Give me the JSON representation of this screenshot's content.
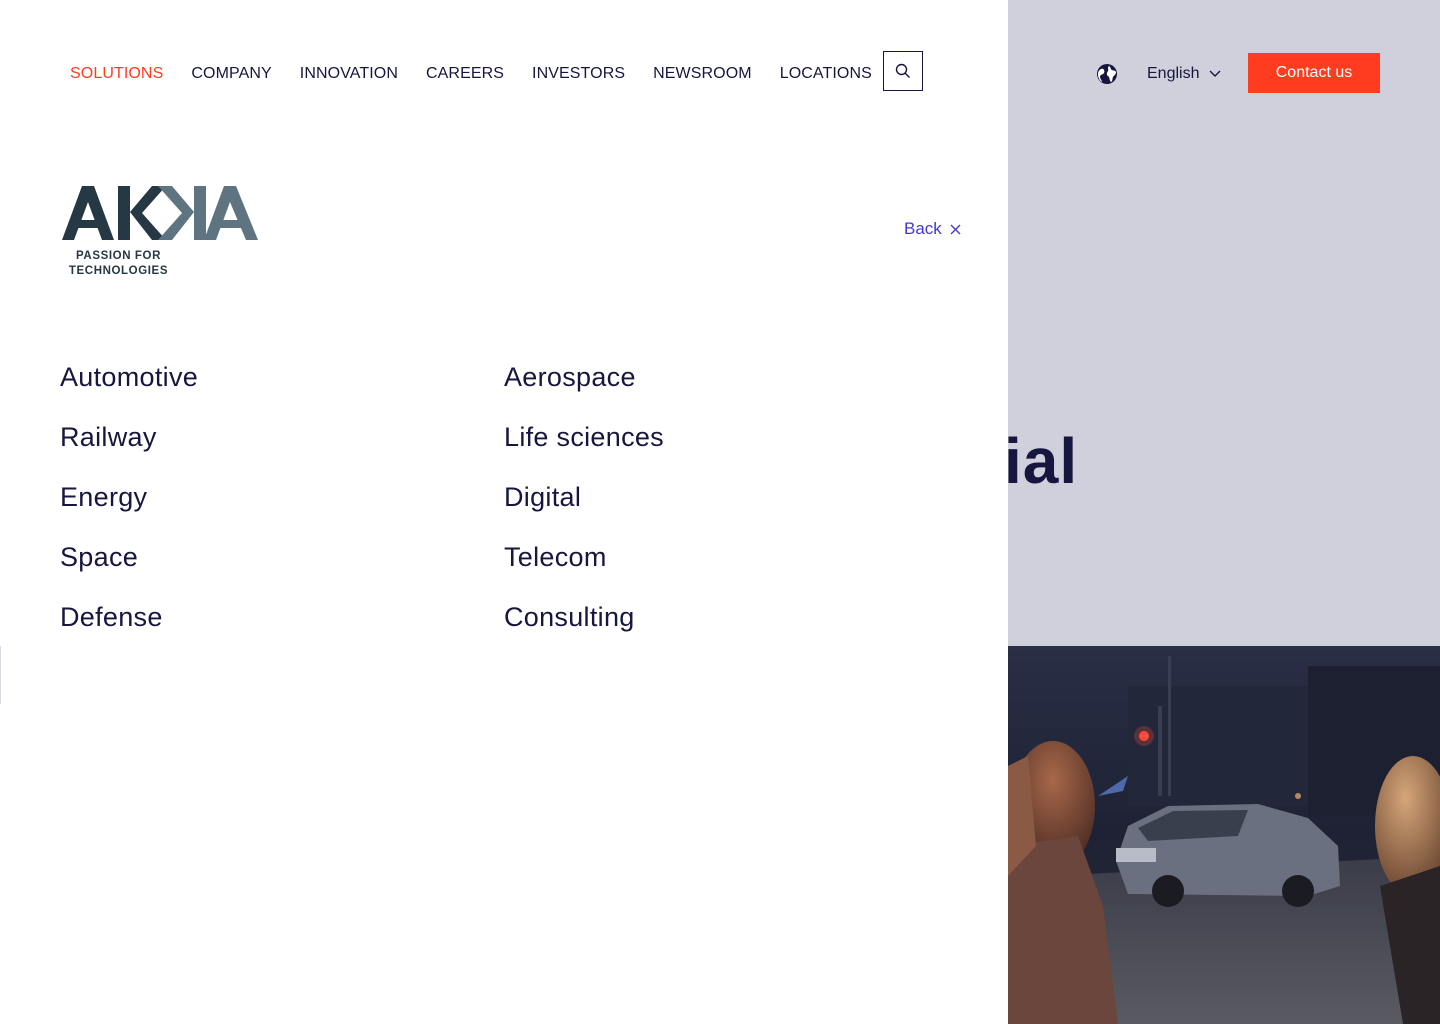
{
  "nav": {
    "items": [
      {
        "label": "SOLUTIONS",
        "active": true
      },
      {
        "label": "COMPANY",
        "active": false
      },
      {
        "label": "INNOVATION",
        "active": false
      },
      {
        "label": "CAREERS",
        "active": false
      },
      {
        "label": "INVESTORS",
        "active": false
      },
      {
        "label": "NEWSROOM",
        "active": false
      },
      {
        "label": "LOCATIONS",
        "active": false
      }
    ],
    "search_icon": "search-icon"
  },
  "header_right": {
    "globe_icon": "globe-icon",
    "language": "English",
    "contact_label": "Contact us"
  },
  "logo": {
    "wordmark": "AKKA",
    "tagline_line1": "PASSION FOR",
    "tagline_line2": "TECHNOLOGIES"
  },
  "back": {
    "label": "Back",
    "icon": "close-icon"
  },
  "solutions": {
    "left": [
      "Automotive",
      "Railway",
      "Energy",
      "Space",
      "Defense"
    ],
    "right": [
      "Aerospace",
      "Life sciences",
      "Digital",
      "Telecom",
      "Consulting"
    ]
  },
  "hero": {
    "visible_fragment": "ial"
  },
  "colors": {
    "accent": "#ff3c1f",
    "text": "#16163f",
    "link": "#4338d6",
    "logo_dark": "#253844",
    "logo_light": "#5e7480",
    "right_background": "#d0d0dc"
  }
}
